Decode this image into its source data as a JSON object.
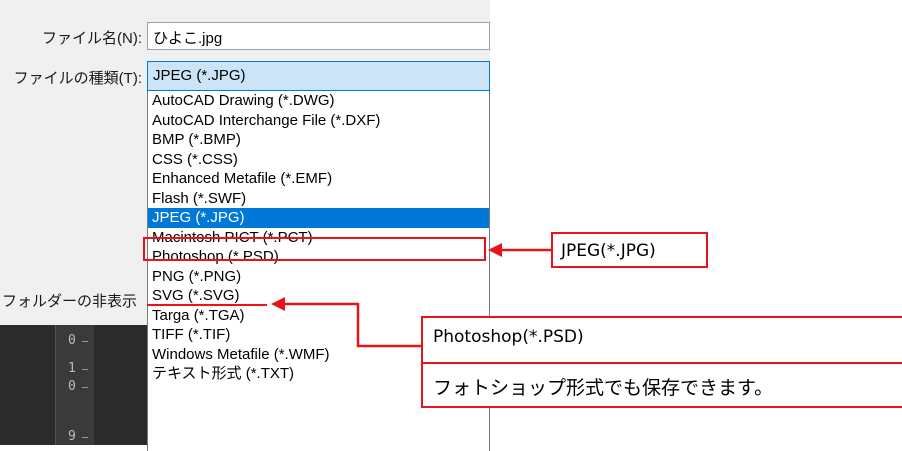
{
  "dialog": {
    "filename_label": "ファイル名(N):",
    "filename_value": "ひよこ.jpg",
    "filetype_label": "ファイルの種類(T):",
    "filetype_selected": "JPEG (*.JPG)",
    "hide_folders_label": "フォルダーの非表示"
  },
  "filetype_options": [
    {
      "label": "AutoCAD Drawing (*.DWG)"
    },
    {
      "label": "AutoCAD Interchange File (*.DXF)"
    },
    {
      "label": "BMP (*.BMP)"
    },
    {
      "label": "CSS (*.CSS)"
    },
    {
      "label": "Enhanced Metafile (*.EMF)"
    },
    {
      "label": "Flash (*.SWF)"
    },
    {
      "label": "JPEG (*.JPG)"
    },
    {
      "label": "Macintosh PICT (*.PCT)"
    },
    {
      "label": "Photoshop (*.PSD)"
    },
    {
      "label": "PNG (*.PNG)"
    },
    {
      "label": "SVG (*.SVG)"
    },
    {
      "label": "Targa (*.TGA)"
    },
    {
      "label": "TIFF (*.TIF)"
    },
    {
      "label": "Windows Metafile (*.WMF)"
    },
    {
      "label": "テキスト形式 (*.TXT)"
    }
  ],
  "selected_option": "JPEG (*.JPG)",
  "ruler": {
    "numbers": [
      "0",
      "1",
      "0",
      "9"
    ]
  },
  "annotations": {
    "callout_jpeg": "JPEG(*.JPG)",
    "callout_psd_title": "Photoshop(*.PSD)",
    "callout_psd_note": "フォトショップ形式でも保存できます。"
  },
  "colors": {
    "accent_red": "#e8141b",
    "selection_blue": "#0078d7",
    "select_bg": "#cce4f7"
  }
}
